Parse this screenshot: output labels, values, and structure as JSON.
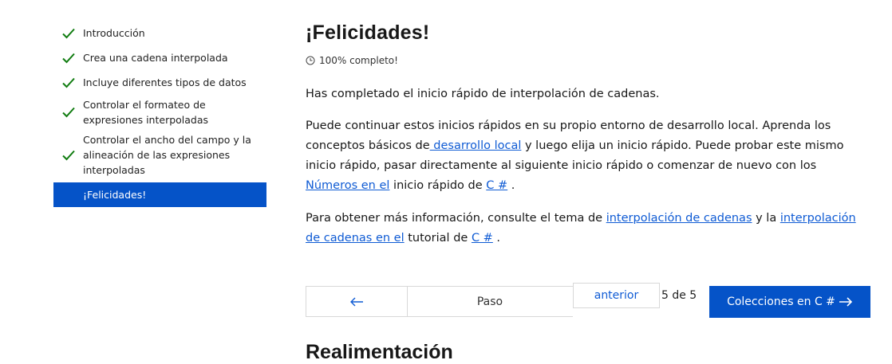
{
  "sidebar": {
    "items": [
      {
        "label": "Introducción",
        "completed": true
      },
      {
        "label": "Crea una cadena interpolada",
        "completed": true
      },
      {
        "label": "Incluye diferentes tipos de datos",
        "completed": true
      },
      {
        "label": "Controlar el formateo de expresiones interpoladas",
        "completed": true
      },
      {
        "label": "Controlar el ancho del campo y la alineación de las expresiones interpoladas",
        "completed": true
      },
      {
        "label": "¡Felicidades!",
        "active": true
      }
    ]
  },
  "main": {
    "title": "¡Felicidades!",
    "progress": "100% completo!",
    "p1": "Has completado el inicio rápido de interpolación de cadenas.",
    "p2": {
      "t1": "Puede continuar estos inicios rápidos en su propio entorno de desarrollo local. Aprenda los conceptos básicos de",
      "link1": " desarrollo local",
      "t2": " y luego elija un inicio rápido. Puede probar este mismo inicio rápido, pasar directamente al siguiente inicio rápido o comenzar de nuevo con los ",
      "link2": "Números en el",
      "t3": " inicio rápido de ",
      "link3": "C #",
      "t4": " ."
    },
    "p3": {
      "t1": "Para obtener más información, consulte el tema de ",
      "link1": "interpolación de cadenas",
      "t2": " y la ",
      "link2": "interpolación de cadenas en el",
      "t3": " tutorial de ",
      "link3": "C #",
      "t4": " ."
    },
    "pager": {
      "prev_icon": "arrow-left-icon",
      "step_label": "Paso",
      "previous_label": "anterior",
      "count": "5 de 5",
      "next_label": "Colecciones en C #",
      "next_icon": "arrow-right-icon"
    },
    "feedback_title": "Realimentación"
  },
  "colors": {
    "accent": "#0553c8",
    "link": "#0f5bd4",
    "check": "#107c10"
  }
}
